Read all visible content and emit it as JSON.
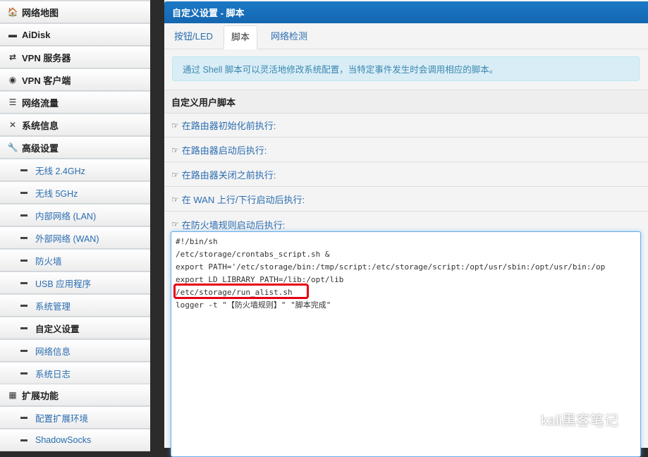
{
  "sidebar": {
    "items": [
      {
        "label": "网络地图",
        "icon": "home-icon",
        "glyph": "🏠"
      },
      {
        "label": "AiDisk",
        "icon": "hdd-icon",
        "glyph": "▬"
      },
      {
        "label": "VPN 服务器",
        "icon": "retweet-icon",
        "glyph": "⇄"
      },
      {
        "label": "VPN 客户端",
        "icon": "globe-icon",
        "glyph": "◉"
      },
      {
        "label": "网络流量",
        "icon": "tasks-icon",
        "glyph": "☰"
      },
      {
        "label": "系统信息",
        "icon": "random-icon",
        "glyph": "✕"
      },
      {
        "label": "高级设置",
        "icon": "wrench-icon",
        "glyph": "🔧"
      }
    ],
    "advanced_sub": [
      {
        "label": "无线 2.4GHz"
      },
      {
        "label": "无线 5GHz"
      },
      {
        "label": "内部网络 (LAN)"
      },
      {
        "label": "外部网络 (WAN)"
      },
      {
        "label": "防火墙"
      },
      {
        "label": "USB 应用程序"
      },
      {
        "label": "系统管理"
      },
      {
        "label": "自定义设置",
        "active": true
      },
      {
        "label": "网络信息"
      },
      {
        "label": "系统日志"
      }
    ],
    "extensions": {
      "label": "扩展功能",
      "icon": "th-icon",
      "glyph": "▦"
    },
    "extensions_sub": [
      {
        "label": "配置扩展环境"
      },
      {
        "label": "ShadowSocks"
      }
    ]
  },
  "panel": {
    "title": "自定义设置 - 脚本",
    "tabs": [
      {
        "label": "按钮/LED"
      },
      {
        "label": "脚本",
        "active": true
      },
      {
        "label": "网络检测"
      }
    ],
    "info": "通过 Shell 脚本可以灵活地修改系统配置，当特定事件发生时会调用相应的脚本。",
    "section_title": "自定义用户脚本",
    "script_rows": [
      {
        "label": "在路由器初始化前执行:"
      },
      {
        "label": "在路由器启动后执行:"
      },
      {
        "label": "在路由器关闭之前执行:"
      },
      {
        "label": "在 WAN 上行/下行启动后执行:"
      },
      {
        "label": "在防火墙规则启动后执行:"
      }
    ],
    "script_lines": [
      "#!/bin/sh",
      "/etc/storage/crontabs_script.sh &",
      "export PATH='/etc/storage/bin:/tmp/script:/etc/storage/script:/opt/usr/sbin:/opt/usr/bin:/op",
      "export LD_LIBRARY_PATH=/lib:/opt/lib",
      "/etc/storage/run_alist.sh",
      "logger -t \"【防火墙规则】\" \"脚本完成\""
    ]
  },
  "watermark": {
    "text": "kali黑客笔记",
    "icon": "wechat-icon"
  },
  "colors": {
    "header": "#1b78c6",
    "link": "#2a6db0",
    "highlight": "#e60012",
    "info_bg": "#d9edf7"
  }
}
